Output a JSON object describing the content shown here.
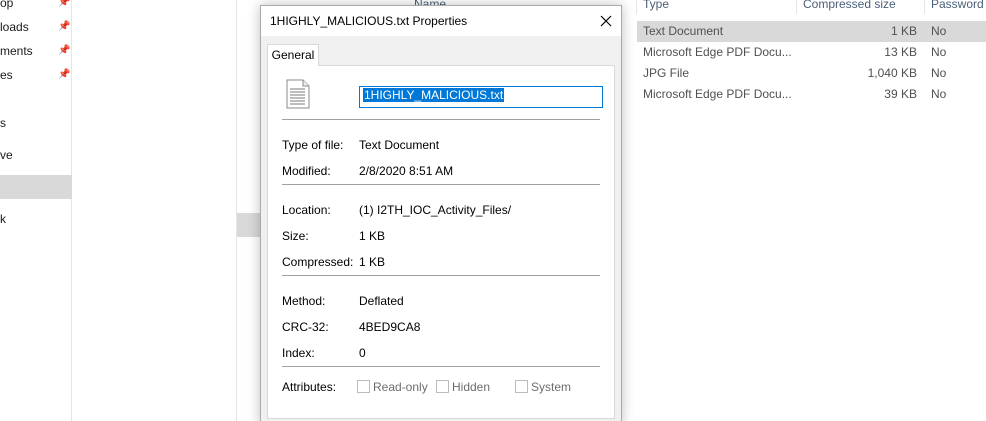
{
  "nav": {
    "items": [
      {
        "label": "Desktop",
        "visible": "op",
        "pinned": true
      },
      {
        "label": "Downloads",
        "visible": "loads",
        "pinned": true
      },
      {
        "label": "Documents",
        "visible": "ments",
        "pinned": true
      },
      {
        "label": "Pictures",
        "visible": "es",
        "pinned": true
      },
      {
        "label": "s",
        "visible": "s",
        "pinned": false
      },
      {
        "label": "ve",
        "visible": "ve",
        "pinned": false
      },
      {
        "label": "",
        "visible": "",
        "pinned": false,
        "selected": true
      },
      {
        "label": "k",
        "visible": "k",
        "pinned": false
      }
    ],
    "pin_glyph": "📌"
  },
  "file_list": {
    "columns": {
      "name": "Name",
      "type": "Type",
      "compressed_size": "Compressed size",
      "password": "Password ..."
    },
    "rows": [
      {
        "type": "Text Document",
        "size": "1 KB",
        "password": "No",
        "selected": true
      },
      {
        "type": "Microsoft Edge PDF Docu...",
        "size": "13 KB",
        "password": "No"
      },
      {
        "type": "JPG File",
        "size": "1,040 KB",
        "password": "No"
      },
      {
        "type": "Microsoft Edge PDF Docu...",
        "size": "39 KB",
        "password": "No"
      }
    ]
  },
  "dialog": {
    "title": "1HIGHLY_MALICIOUS.txt Properties",
    "close_icon": "close-icon",
    "tab": "General",
    "file_name": "1HIGHLY_MALICIOUS.txt",
    "fields": {
      "type_label": "Type of file:",
      "type_value": "Text Document",
      "modified_label": "Modified:",
      "modified_value": "2/8/2020 8:51 AM",
      "location_label": "Location:",
      "location_value": "(1) I2TH_IOC_Activity_Files/",
      "size_label": "Size:",
      "size_value": "1 KB",
      "compressed_label": "Compressed:",
      "compressed_value": "1 KB",
      "method_label": "Method:",
      "method_value": "Deflated",
      "crc_label": "CRC-32:",
      "crc_value": "4BED9CA8",
      "index_label": "Index:",
      "index_value": "0",
      "attributes_label": "Attributes:"
    },
    "attributes": [
      {
        "label": "Read-only",
        "checked": false
      },
      {
        "label": "Hidden",
        "checked": false
      },
      {
        "label": "System",
        "checked": false
      }
    ]
  },
  "colors": {
    "selection_blue": "#0078d7",
    "row_selected": "#d9d9d9",
    "dialog_bg": "#f0f0f0",
    "header_text": "#4c607a"
  }
}
